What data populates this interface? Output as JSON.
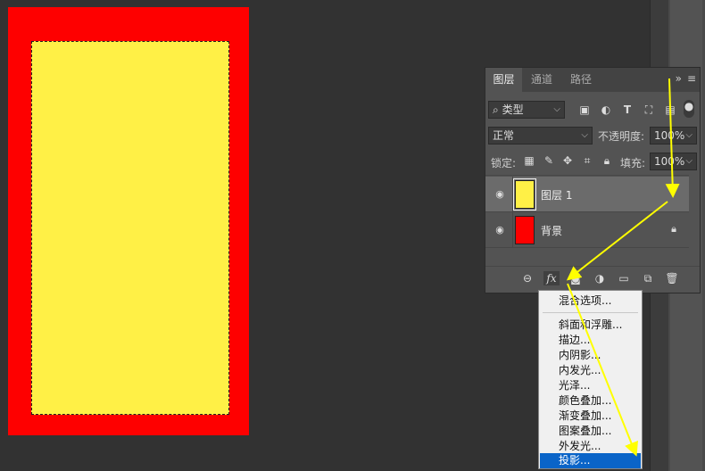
{
  "layers_panel": {
    "tabs": [
      {
        "label": "图层"
      },
      {
        "label": "通道"
      },
      {
        "label": "路径"
      }
    ],
    "filter": {
      "value": "类型"
    },
    "blend_mode": {
      "value": "正常"
    },
    "opacity": {
      "label": "不透明度:",
      "value": "100%"
    },
    "lock": {
      "label": "锁定:"
    },
    "fill": {
      "label": "填充:",
      "value": "100%"
    },
    "layers": [
      {
        "name": "图层 1",
        "color": "#fff046",
        "selected": true
      },
      {
        "name": "背景",
        "color": "#fe0000",
        "locked": true
      }
    ],
    "footer": {
      "fx_label": "fx"
    }
  },
  "context_menu": {
    "items": [
      {
        "label": "混合选项..."
      },
      {
        "label": "斜面和浮雕..."
      },
      {
        "label": "描边..."
      },
      {
        "label": "内阴影..."
      },
      {
        "label": "内发光..."
      },
      {
        "label": "光泽..."
      },
      {
        "label": "颜色叠加..."
      },
      {
        "label": "渐变叠加..."
      },
      {
        "label": "图案叠加..."
      },
      {
        "label": "外发光..."
      },
      {
        "label": "投影..."
      }
    ],
    "highlighted": "投影..."
  },
  "colors": {
    "background_layer": "#fe0000",
    "layer1_fill": "#fff046",
    "annotation_arrow": "#ffff00",
    "menu_highlight": "#0a64c8"
  }
}
